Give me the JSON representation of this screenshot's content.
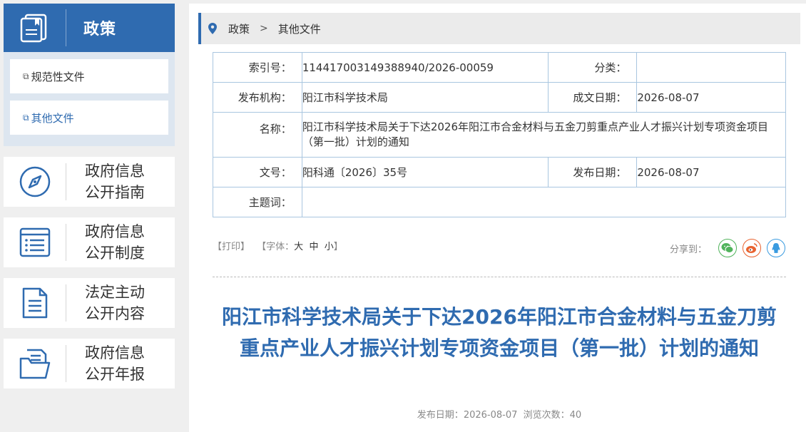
{
  "sidebar": {
    "policy": {
      "title": "政策",
      "icon": "documents-icon",
      "items": [
        {
          "label": "规范性文件",
          "active": false
        },
        {
          "label": "其他文件",
          "active": true
        }
      ]
    },
    "cards": [
      {
        "line1": "政府信息",
        "line2": "公开指南",
        "icon": "compass-icon"
      },
      {
        "line1": "政府信息",
        "line2": "公开制度",
        "icon": "list-icon"
      },
      {
        "line1": "法定主动",
        "line2": "公开内容",
        "icon": "document-lines-icon"
      },
      {
        "line1": "政府信息",
        "line2": "公开年报",
        "icon": "folder-icon"
      }
    ],
    "colors": {
      "accent": "#2f6bb0",
      "sub_bg": "#dde6f0"
    }
  },
  "breadcrumb": {
    "items": [
      "政策",
      "其他文件"
    ],
    "separator": ">"
  },
  "meta": {
    "index_label": "索引号：",
    "index_value": "114417003149388940/2026-00059",
    "category_label": "分类：",
    "category_value": "",
    "org_label": "发布机构：",
    "org_value": "阳江市科学技术局",
    "created_label": "成文日期：",
    "created_value": "2026-08-07",
    "name_label": "名称：",
    "name_value": "阳江市科学技术局关于下达2026年阳江市合金材料与五金刀剪重点产业人才振兴计划专项资金项目（第一批）计划的通知",
    "docno_label": "文号：",
    "docno_value": "阳科通〔2026〕35号",
    "pubdate_label": "发布日期：",
    "pubdate_value": "2026-08-07",
    "keywords_label": "主题词：",
    "keywords_value": ""
  },
  "tools": {
    "print": "【打印】",
    "font_prefix": "【字体：",
    "font_large": "大",
    "font_medium": "中",
    "font_small": "小",
    "font_suffix": "】"
  },
  "share": {
    "label": "分享到：",
    "targets": [
      "wechat-icon",
      "weibo-icon",
      "qq-icon"
    ]
  },
  "article": {
    "title": "阳江市科学技术局关于下达2026年阳江市合金材料与五金刀剪重点产业人才振兴计划专项资金项目（第一批）计划的通知",
    "pub_label": "发布日期：",
    "pub_date": "2026-08-07",
    "views_label": "浏览次数：",
    "views": "40"
  }
}
